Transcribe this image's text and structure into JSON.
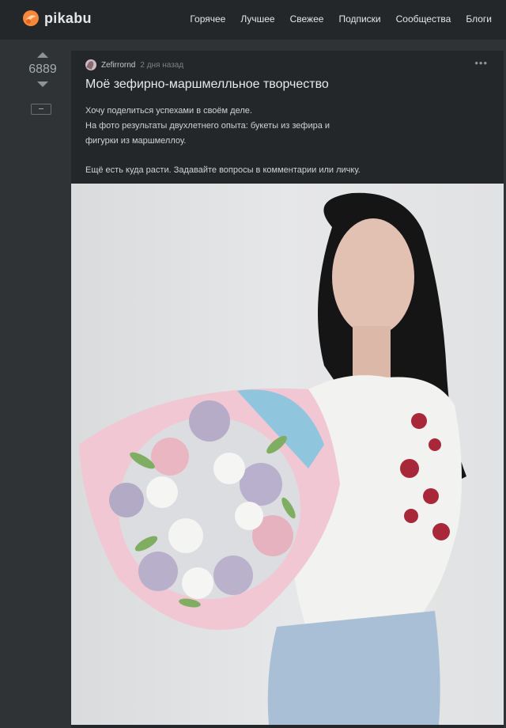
{
  "header": {
    "logo_text": "pikabu",
    "nav": [
      "Горячее",
      "Лучшее",
      "Свежее",
      "Подписки",
      "Сообщества",
      "Блоги"
    ]
  },
  "rating": {
    "value": "6889"
  },
  "story": {
    "author": "Zefirrornd",
    "time": "2 дня назад",
    "title": "Моё зефирно-маршмелльное творчество",
    "text": {
      "line1": "Хочу поделиться успехами в своём деле.",
      "line2": "На фото результаты двухлетнего опыта: букеты из зефира и",
      "line3": "фигурки из маршмеллоу.",
      "line4": "Ещё есть куда расти. Задавайте вопросы в комментарии или личку."
    }
  },
  "colors": {
    "background": "#2f3336",
    "header": "#242729",
    "card": "#242729",
    "logo_accent": "#f5883a"
  }
}
